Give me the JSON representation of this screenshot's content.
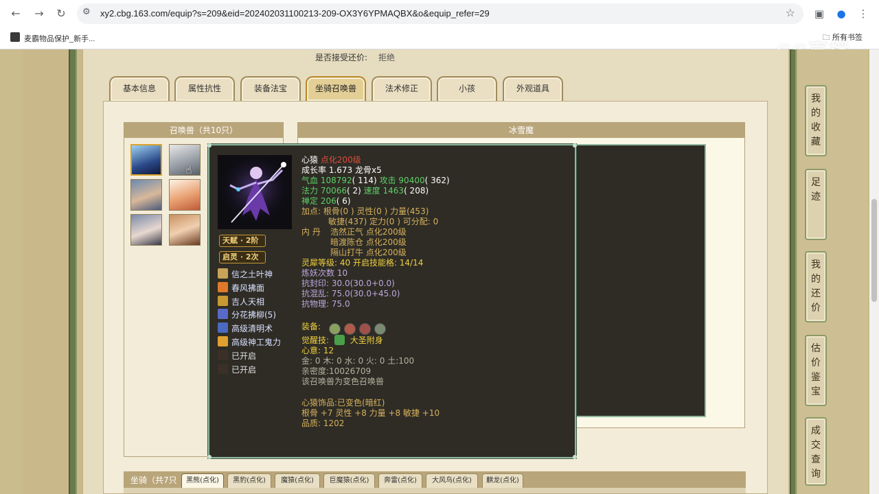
{
  "browser": {
    "url": "xy2.cbg.163.com/equip?s=209&eid=202402031100213-209-OX3Y6YPMAQBX&o&equip_refer=29",
    "bookmark_label": "麦霸物品保护_新手...",
    "bookmarks_folder": "所有书签",
    "watermark": "CC直播"
  },
  "page": {
    "bargain_label": "是否接受还价:",
    "bargain_value": "拒绝",
    "tabs": [
      "基本信息",
      "属性抗性",
      "装备法宝",
      "坐骑召唤兽",
      "法术修正",
      "小孩",
      "外观道具"
    ],
    "active_tab": "坐骑召唤兽",
    "pets_title": "召唤兽（共10只）",
    "detail_title": "冰雪魔",
    "detail_fragments": [
      "2)",
      "0)"
    ],
    "mounts_title": "坐骑（共7只",
    "mount_tabs": [
      "黑熊(点化)",
      "黑豹(点化)",
      "魔猿(点化)",
      "巨魔猿(点化)",
      "奔雷(点化)",
      "大风鸟(点化)",
      "麒龙(点化)"
    ],
    "side_nav": [
      "我的收藏",
      "足迹",
      "我的还价",
      "估价鉴宝",
      "成交查询"
    ]
  },
  "tooltip": {
    "name": "心猿",
    "name_note": "点化200级",
    "growth": "成长率 1.673 龙骨x5",
    "hp_label": "气血",
    "hp_value": "108792",
    "hp_add": "( 114)",
    "atk_label": "攻击",
    "atk_value": "90400",
    "atk_add": "( 362)",
    "mp_label": "法力",
    "mp_value": "70066",
    "mp_add": "( 2)",
    "spd_label": "速度",
    "spd_value": "1463",
    "spd_add": "( 208)",
    "calm_label": "禅定",
    "calm_value": "206",
    "calm_add": "( 6)",
    "points_1": "加点:  根骨(0 ) 灵性(0 ) 力量(453)",
    "points_2": "敏捷(437) 定力(0 ) 可分配:  0",
    "neidan_label": "内  丹",
    "neidan_1": "浩然正气 点化200级",
    "neidan_2": "暗渡陈仓 点化200级",
    "neidan_3": "隔山打牛 点化200级",
    "lingxi": "灵犀等级:  40 开启技能格:  14/14",
    "lianyao": "炼妖次数 10",
    "res_seal": "抗封印: 30.0(30.0+0.0)",
    "res_chaos": "抗混乱: 75.0(30.0+45.0)",
    "res_phys": "抗物理: 75.0",
    "equip_label": "装备:",
    "awaken_label": "觉醒技:",
    "awaken_value": "大圣附身",
    "xinyi": "心意:  12",
    "elements": "金: 0 木: 0 水: 0 火: 0 土:100",
    "intimacy": "亲密度:10026709",
    "variant": "该召唤兽为变色召唤兽",
    "ornament": "心猿饰品:已变色(暗红)",
    "ornament_stats": "根骨 +7 灵性 +8 力量 +8 敏捷 +10",
    "quality": "品质:  1202",
    "badges": [
      {
        "name": "天赋",
        "value": "2阶"
      },
      {
        "name": "启灵",
        "value": "2次"
      }
    ],
    "skills": [
      {
        "label": "信之土叶神",
        "icon_color": "#c9a35a"
      },
      {
        "label": "春风拂面",
        "icon_color": "#e0792a"
      },
      {
        "label": "吉人天相",
        "icon_color": "#c89832"
      },
      {
        "label": "分花拂柳(5)",
        "icon_color": "#5a6ac8"
      },
      {
        "label": "高级清明术",
        "icon_color": "#4a6ac0"
      },
      {
        "label": "高级神工鬼力",
        "icon_color": "#e0a030"
      },
      {
        "label": "已开启",
        "icon_color": "#3a3028"
      },
      {
        "label": "已开启",
        "icon_color": "#3a3028"
      }
    ],
    "equip_icons": [
      "#8aa060",
      "#b05a4a",
      "#a0504a",
      "#7a8a70"
    ]
  }
}
